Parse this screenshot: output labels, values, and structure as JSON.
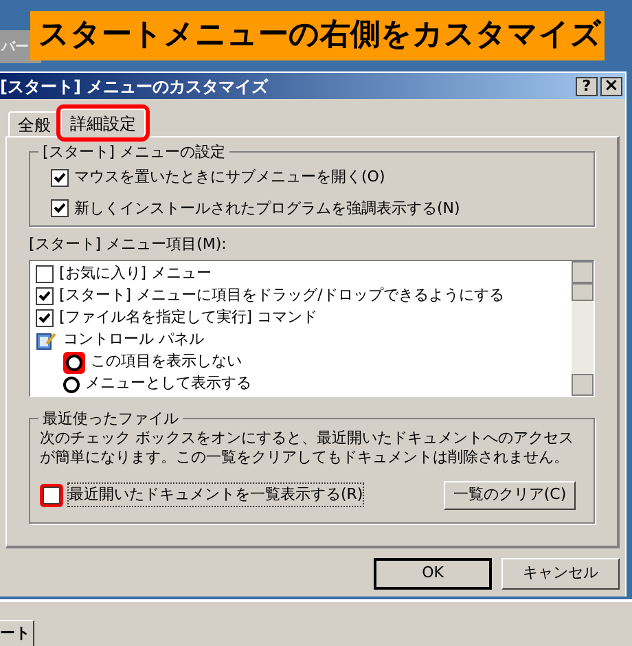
{
  "banner": {
    "text": "スタートメニューの右側をカスタマイズ"
  },
  "background_window": {
    "title": "バー"
  },
  "dialog": {
    "title": "[スタート] メニューのカスタマイズ",
    "help_button": "?",
    "close_button": "×"
  },
  "tabs": [
    {
      "label": "全般",
      "selected": false,
      "highlighted": false
    },
    {
      "label": "詳細設定",
      "selected": true,
      "highlighted": true
    }
  ],
  "settings_group": {
    "title": "[スタート] メニューの設定",
    "options": [
      {
        "label": "マウスを置いたときにサブメニューを開く(O)",
        "checked": true
      },
      {
        "label": "新しくインストールされたプログラムを強調表示する(N)",
        "checked": true
      }
    ]
  },
  "menu_items": {
    "label": "[スタート] メニュー項目(M):",
    "items": [
      {
        "kind": "checkbox",
        "label": "[お気に入り] メニュー",
        "checked": false
      },
      {
        "kind": "checkbox",
        "label": "[スタート] メニューに項目をドラッグ/ドロップできるようにする",
        "checked": true
      },
      {
        "kind": "checkbox",
        "label": "[ファイル名を指定して実行] コマンド",
        "checked": true
      },
      {
        "kind": "category",
        "label": "コントロール パネル",
        "children": [
          {
            "kind": "radio",
            "label": "この項目を表示しない",
            "selected": false,
            "highlighted": true
          },
          {
            "kind": "radio",
            "label": "メニューとして表示する",
            "selected": false,
            "highlighted": false
          }
        ]
      }
    ]
  },
  "recent": {
    "title": "最近使ったファイル",
    "description": "次のチェック ボックスをオンにすると、最近開いたドキュメントへのアクセスが簡単になります。この一覧をクリアしてもドキュメントは削除されません。",
    "checkbox": {
      "label": "最近開いたドキュメントを一覧表示する(R)",
      "checked": false,
      "highlighted": true
    },
    "clear_button": "一覧のクリア(C)"
  },
  "buttons": [
    {
      "label": "OK",
      "kind": "default"
    },
    {
      "label": "キャンセル",
      "kind": "normal"
    }
  ],
  "taskbar": {
    "start_button": "ート"
  }
}
